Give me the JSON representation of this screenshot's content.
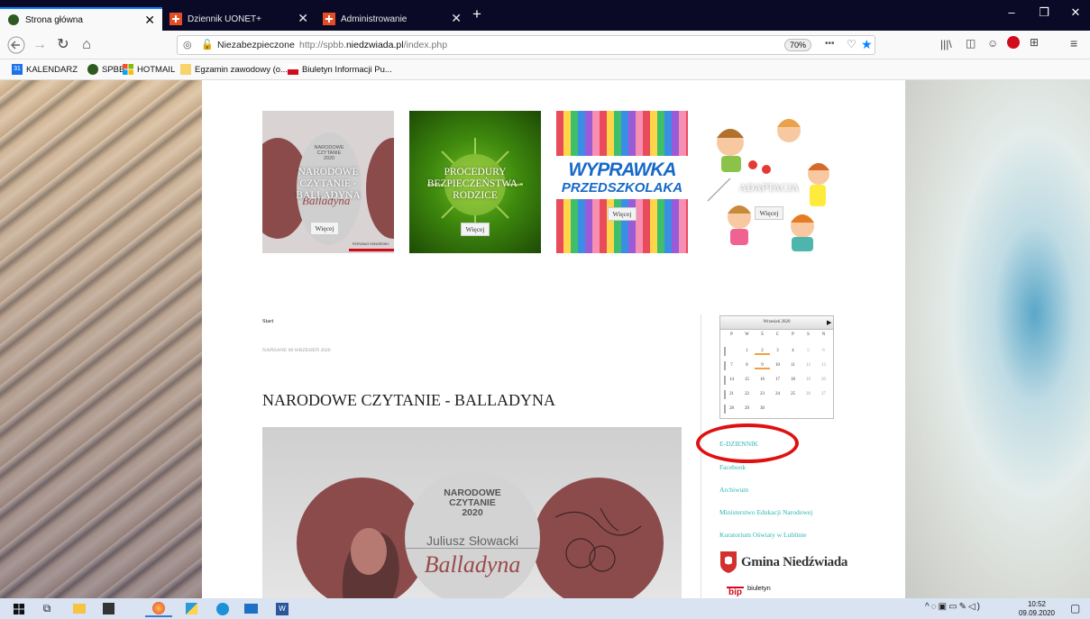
{
  "tabs": [
    {
      "title": "Strona główna",
      "active": true
    },
    {
      "title": "Dziennik UONET+",
      "active": false
    },
    {
      "title": "Administrowanie",
      "active": false
    }
  ],
  "new_tab_symbol": "+",
  "window_controls": {
    "minimize": "–",
    "restore": "❐",
    "close": "✕"
  },
  "nav": {
    "security_label": "Niezabezpieczone",
    "url_prefix": "http://spbb.",
    "url_domain": "niedzwiada.pl",
    "url_path": "/index.php",
    "zoom": "70%",
    "more_symbol": "•••"
  },
  "bookmarks": [
    {
      "label": "KALENDARZ",
      "icon": "calendar-icon"
    },
    {
      "label": "SPBB",
      "icon": "circle-icon"
    },
    {
      "label": "HOTMAIL",
      "icon": "windows-icon"
    },
    {
      "label": "Egzamin zawodowy (o...",
      "icon": "folder-icon"
    },
    {
      "label": "Biuletyn Informacji Pu...",
      "icon": "bip-icon"
    }
  ],
  "cards": [
    {
      "title": "NARODOWE CZYTANIE - BALLADYNA",
      "button": "Więcej",
      "poster_line1": "NARODOWE",
      "poster_line2": "CZYTANIE",
      "poster_line3": "2020",
      "poster_script": "Balladyna",
      "poster_footer": "PATRONAT HONOROWY"
    },
    {
      "title": "PROCEDURY BEZPIECZEŃSTWA - RODZICE",
      "button": "Więcej"
    },
    {
      "title": "",
      "button": "Więcej",
      "poster_line1": "WYPRAWKA",
      "poster_line2": "PRZEDSZKOLAKA"
    },
    {
      "title": "ADAPTACJA",
      "button": "Więcej"
    }
  ],
  "breadcrumb": "Start",
  "article": {
    "meta": "NAPISANE 08 WRZESIEŃ 2020",
    "title": "NARODOWE CZYTANIE - BALLADYNA",
    "poster_line1": "NARODOWE",
    "poster_line2": "CZYTANIE",
    "poster_line3": "2020",
    "poster_author": "Juliusz Słowacki",
    "poster_script": "Balladyna"
  },
  "calendar": {
    "month": "Wrzesień 2020",
    "weekdays": [
      "P",
      "W",
      "Ś",
      "C",
      "P",
      "S",
      "N"
    ],
    "weeks": [
      [
        "",
        "1",
        "2",
        "3",
        "4",
        "5",
        "6"
      ],
      [
        "7",
        "8",
        "9",
        "10",
        "11",
        "12",
        "13"
      ],
      [
        "14",
        "15",
        "16",
        "17",
        "18",
        "19",
        "20"
      ],
      [
        "21",
        "22",
        "23",
        "24",
        "25",
        "26",
        "27"
      ],
      [
        "28",
        "29",
        "30",
        "",
        "",
        "",
        ""
      ]
    ],
    "highlighted": [
      "2",
      "9"
    ]
  },
  "side_links": [
    "E-DZIENNIK",
    "Facebook",
    "Archiwum",
    "Ministerstwo Edukacji Narodowej",
    "Kuratorium Oświaty w Lublinie"
  ],
  "gmina": "Gmina Niedźwiada",
  "bip": {
    "badge": "bip",
    "label": "biuletyn"
  },
  "clock": {
    "time": "10:52",
    "date": "09.09.2020"
  },
  "colors": {
    "link": "#2bb7b3",
    "annotation": "#e01010",
    "tabbar": "#0a0a26"
  }
}
